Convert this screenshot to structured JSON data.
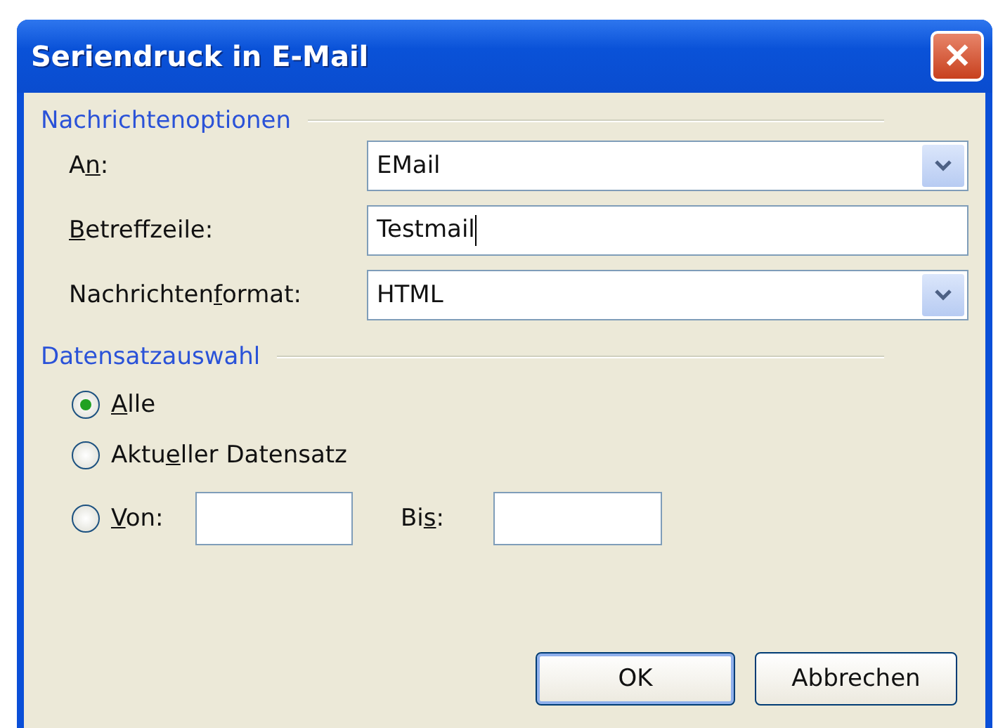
{
  "window": {
    "title": "Seriendruck in E-Mail",
    "close_glyph": "✕"
  },
  "message_options": {
    "heading": "Nachrichtenoptionen",
    "fields": [
      {
        "kind": "dropdown",
        "label_parts": [
          {
            "text": "A",
            "underlined": false
          },
          {
            "text": "n",
            "underlined": true
          },
          {
            "text": ":",
            "underlined": false
          }
        ],
        "value": "EMail"
      },
      {
        "kind": "text",
        "label_parts": [
          {
            "text": "B",
            "underlined": true
          },
          {
            "text": "etreffzeile:",
            "underlined": false
          }
        ],
        "value": "Testmail",
        "focused": true
      },
      {
        "kind": "dropdown",
        "label_parts": [
          {
            "text": "Nachrichten",
            "underlined": false
          },
          {
            "text": "f",
            "underlined": true
          },
          {
            "text": "ormat:",
            "underlined": false
          }
        ],
        "value": "HTML"
      }
    ]
  },
  "record_selection": {
    "heading": "Datensatzauswahl",
    "options": [
      {
        "kind": "plain",
        "selected": true,
        "label_parts": [
          {
            "text": "A",
            "underlined": true
          },
          {
            "text": "lle",
            "underlined": false
          }
        ]
      },
      {
        "kind": "plain",
        "selected": false,
        "label_parts": [
          {
            "text": "Aktu",
            "underlined": false
          },
          {
            "text": "e",
            "underlined": true
          },
          {
            "text": "ller Datensatz",
            "underlined": false
          }
        ]
      },
      {
        "kind": "range",
        "selected": false,
        "label_parts": [
          {
            "text": "V",
            "underlined": true
          },
          {
            "text": "on:",
            "underlined": false
          }
        ],
        "to_label_parts": [
          {
            "text": "Bi",
            "underlined": false
          },
          {
            "text": "s",
            "underlined": true
          },
          {
            "text": ":",
            "underlined": false
          }
        ]
      }
    ]
  },
  "buttons": [
    {
      "label": "OK",
      "default": true
    },
    {
      "label": "Abbrechen",
      "default": false
    }
  ]
}
